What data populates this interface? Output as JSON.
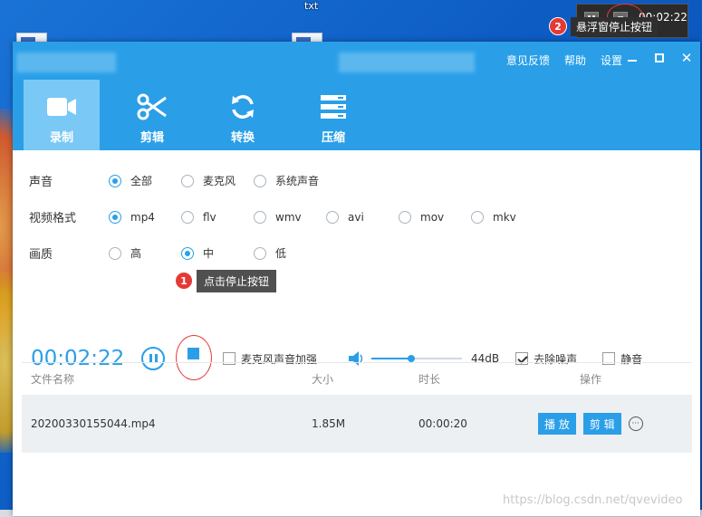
{
  "desktop": {
    "file_label": "txt"
  },
  "floating_widget": {
    "time": "00:02:22",
    "callout_number": "2",
    "callout_text": "悬浮窗停止按钮"
  },
  "window": {
    "top_links": [
      "意见反馈",
      "帮助",
      "设置"
    ],
    "tabs": [
      {
        "label": "录制",
        "icon": "video-camera-icon",
        "active": true
      },
      {
        "label": "剪辑",
        "icon": "scissors-icon",
        "active": false
      },
      {
        "label": "转换",
        "icon": "refresh-icon",
        "active": false
      },
      {
        "label": "压缩",
        "icon": "compress-icon",
        "active": false
      }
    ]
  },
  "settings": {
    "sound": {
      "label": "声音",
      "options": [
        "全部",
        "麦克风",
        "系统声音"
      ],
      "selected": 0
    },
    "format": {
      "label": "视频格式",
      "options": [
        "mp4",
        "flv",
        "wmv",
        "avi",
        "mov",
        "mkv"
      ],
      "selected": 0
    },
    "quality": {
      "label": "画质",
      "options": [
        "高",
        "中",
        "低"
      ],
      "selected": 1
    }
  },
  "tooltip": {
    "number": "1",
    "text": "点击停止按钮"
  },
  "controls": {
    "timer": "00:02:22",
    "mic_boost_label": "麦克风声音加强",
    "mic_boost_checked": false,
    "volume_label": "44dB",
    "volume_fraction": 0.44,
    "denoise_label": "去除噪声",
    "denoise_checked": true,
    "mute_label": "静音",
    "mute_checked": false
  },
  "table": {
    "headers": [
      "文件名称",
      "大小",
      "时长",
      "操作"
    ],
    "rows": [
      {
        "name": "20200330155044.mp4",
        "size": "1.85M",
        "duration": "00:00:20",
        "play_label": "播 放",
        "edit_label": "剪 辑"
      }
    ]
  },
  "watermark": "https://blog.csdn.net/qvevideo",
  "colors": {
    "accent": "#2a9fe8",
    "annotation_red": "#e53935"
  }
}
